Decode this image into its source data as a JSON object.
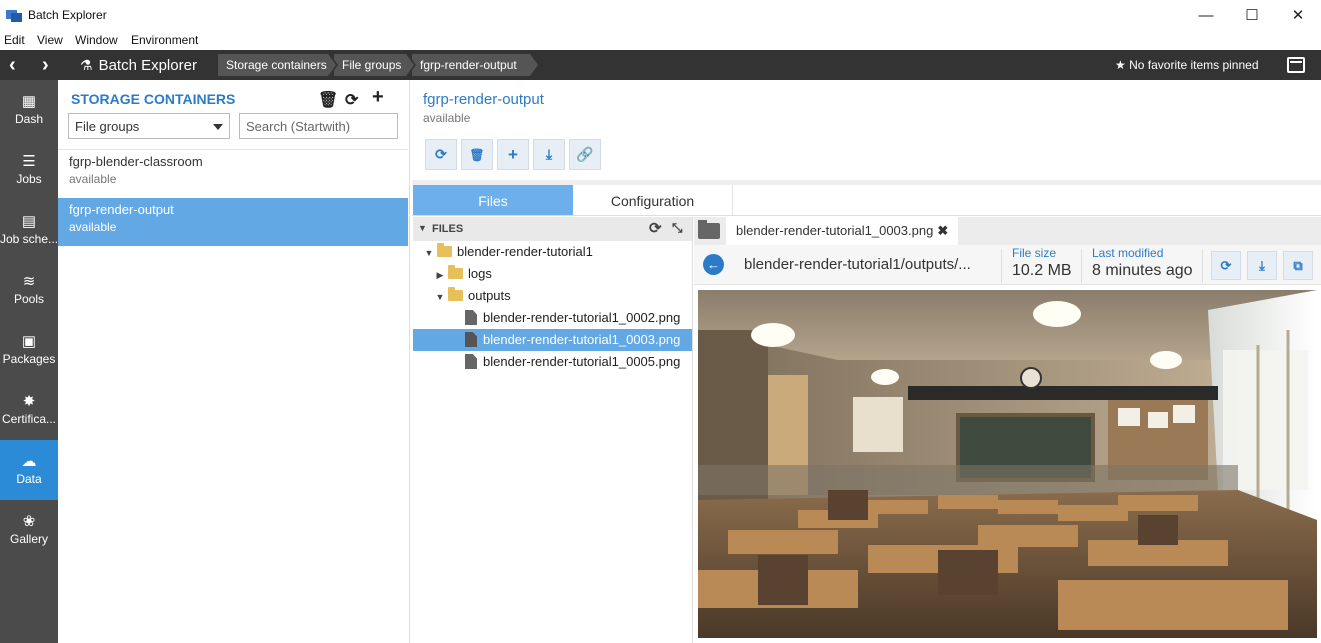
{
  "window": {
    "title": "Batch Explorer",
    "minimize": "—",
    "maximize": "☐",
    "close": "✕"
  },
  "menu": [
    "Edit",
    "View",
    "Window",
    "Environment"
  ],
  "header": {
    "brand": "Batch Explorer",
    "breadcrumbs": [
      "Storage containers",
      "File groups",
      "fgrp-render-output"
    ],
    "pinned": "★ No favorite items pinned"
  },
  "nav": [
    {
      "label": "Dash",
      "icon": "dashboard-icon"
    },
    {
      "label": "Jobs",
      "icon": "jobs-icon"
    },
    {
      "label": "Job sche...",
      "icon": "calendar-icon"
    },
    {
      "label": "Pools",
      "icon": "database-icon"
    },
    {
      "label": "Packages",
      "icon": "package-icon"
    },
    {
      "label": "Certifica...",
      "icon": "certificate-icon"
    },
    {
      "label": "Data",
      "icon": "cloud-upload-icon"
    },
    {
      "label": "Gallery",
      "icon": "gallery-icon"
    }
  ],
  "storage": {
    "title": "STORAGE CONTAINERS",
    "filter_value": "File groups",
    "search_placeholder": "Search (Startwith)",
    "items": [
      {
        "name": "fgrp-blender-classroom",
        "status": "available"
      },
      {
        "name": "fgrp-render-output",
        "status": "available"
      }
    ]
  },
  "main": {
    "title": "fgrp-render-output",
    "status": "available",
    "tabs": [
      "Files",
      "Configuration"
    ]
  },
  "tree": {
    "header": "FILES",
    "root": "blender-render-tutorial1",
    "folders": [
      "logs",
      "outputs"
    ],
    "files": [
      "blender-render-tutorial1_0002.png",
      "blender-render-tutorial1_0003.png",
      "blender-render-tutorial1_0005.png"
    ]
  },
  "viewer": {
    "tab_label": "blender-render-tutorial1_0003.png",
    "path": "blender-render-tutorial1/outputs/...",
    "size_label": "File size",
    "size_value": "10.2 MB",
    "modified_label": "Last modified",
    "modified_value": "8 minutes ago"
  },
  "colors": {
    "accent": "#2b7bc9",
    "selection": "#62a8e5",
    "header_bg": "#333333",
    "nav_bg": "#4b4b4b"
  }
}
